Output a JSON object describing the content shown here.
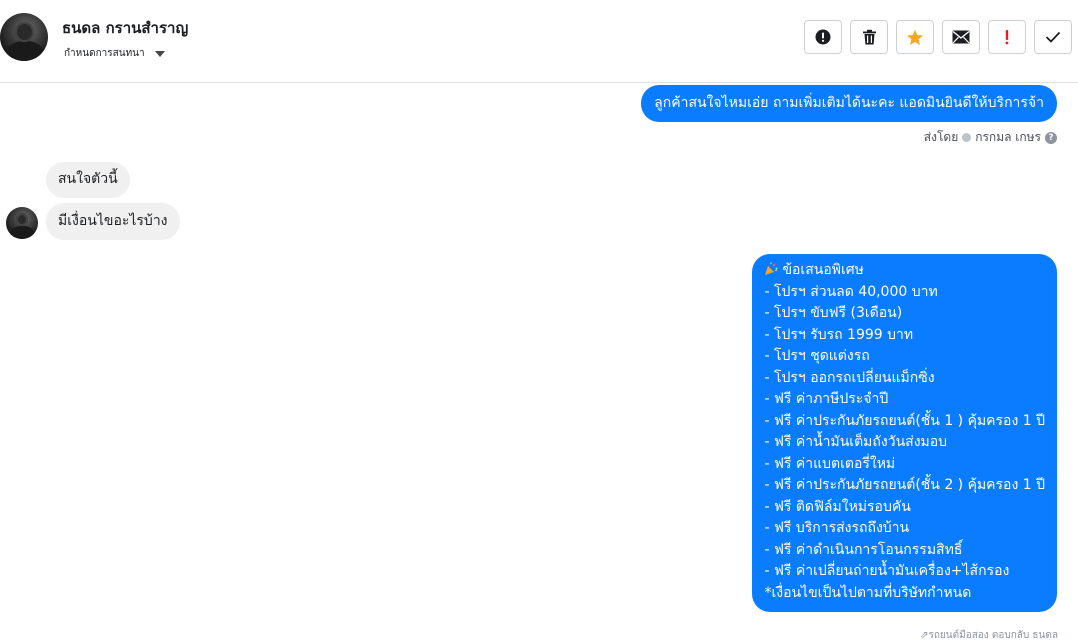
{
  "contact": {
    "name": "ธนดล กรานสำราญ",
    "subtitle": "กำหนดการสนทนา"
  },
  "toolbar": {
    "buttons": [
      {
        "icon": "alert-circle-icon",
        "color": "#1c1e21"
      },
      {
        "icon": "trash-icon",
        "color": "#1c1e21"
      },
      {
        "icon": "star-icon",
        "color": "#f5a623"
      },
      {
        "icon": "envelope-icon",
        "color": "#1c1e21"
      },
      {
        "icon": "exclamation-icon",
        "color": "#e02020"
      },
      {
        "icon": "check-icon",
        "color": "#1c1e21"
      }
    ]
  },
  "messages": {
    "m1": "ลูกค้าสนใจไหมเอ่ย ถามเพิ่มเติมได้นะคะ แอดมินยินดีให้บริการจ้า",
    "sent_by_label": "ส่งโดย",
    "sent_by_name": "กรกมล เกษร",
    "m2": "สนใจตัวนี้",
    "m3": "มีเงื่อนไขอะไรบ้าง",
    "m4": {
      "title": "ข้อเสนอพิเศษ",
      "lines": [
        " - โปรฯ ส่วนลด 40,000 บาท",
        " - โปรฯ ขับฟรี (3เดือน)",
        " - โปรฯ รับรถ 1999 บาท",
        " - โปรฯ ชุดแต่งรถ",
        " - โปรฯ ออกรถเปลี่ยนแม็กซิ่ง",
        " - ฟรี ค่าภาษีประจำปี",
        " - ฟรี ค่าประกันภัยรถยนต์(ชั้น 1 ) คุ้มครอง 1 ปี",
        " - ฟรี ค่าน้ำมันเต็มถังวันส่งมอบ",
        " - ฟรี ค่าแบตเตอรี่ใหม่",
        " - ฟรี ค่าประกันภัยรถยนต์(ชั้น 2 ) คุ้มครอง 1 ปี",
        " - ฟรี ติดฟิล์มใหม่รอบคัน",
        " - ฟรี บริการส่งรถถึงบ้าน",
        " - ฟรี ค่าดำเนินการโอนกรรมสิทธิ์",
        " - ฟรี ค่าเปลี่ยนถ่ายน้ำมันเครื่อง+ไส้กรอง"
      ],
      "footer": "*เงื่อนไขเป็นไปตามที่บริษัทกำหนด"
    },
    "reply_note": "รถยนต์มือสอง ตอบกลับ ธนดล"
  },
  "colors": {
    "outgoing_bubble": "#0a7cff",
    "incoming_bubble": "#f0f0f0",
    "star": "#f5a623",
    "exclamation": "#e02020"
  }
}
